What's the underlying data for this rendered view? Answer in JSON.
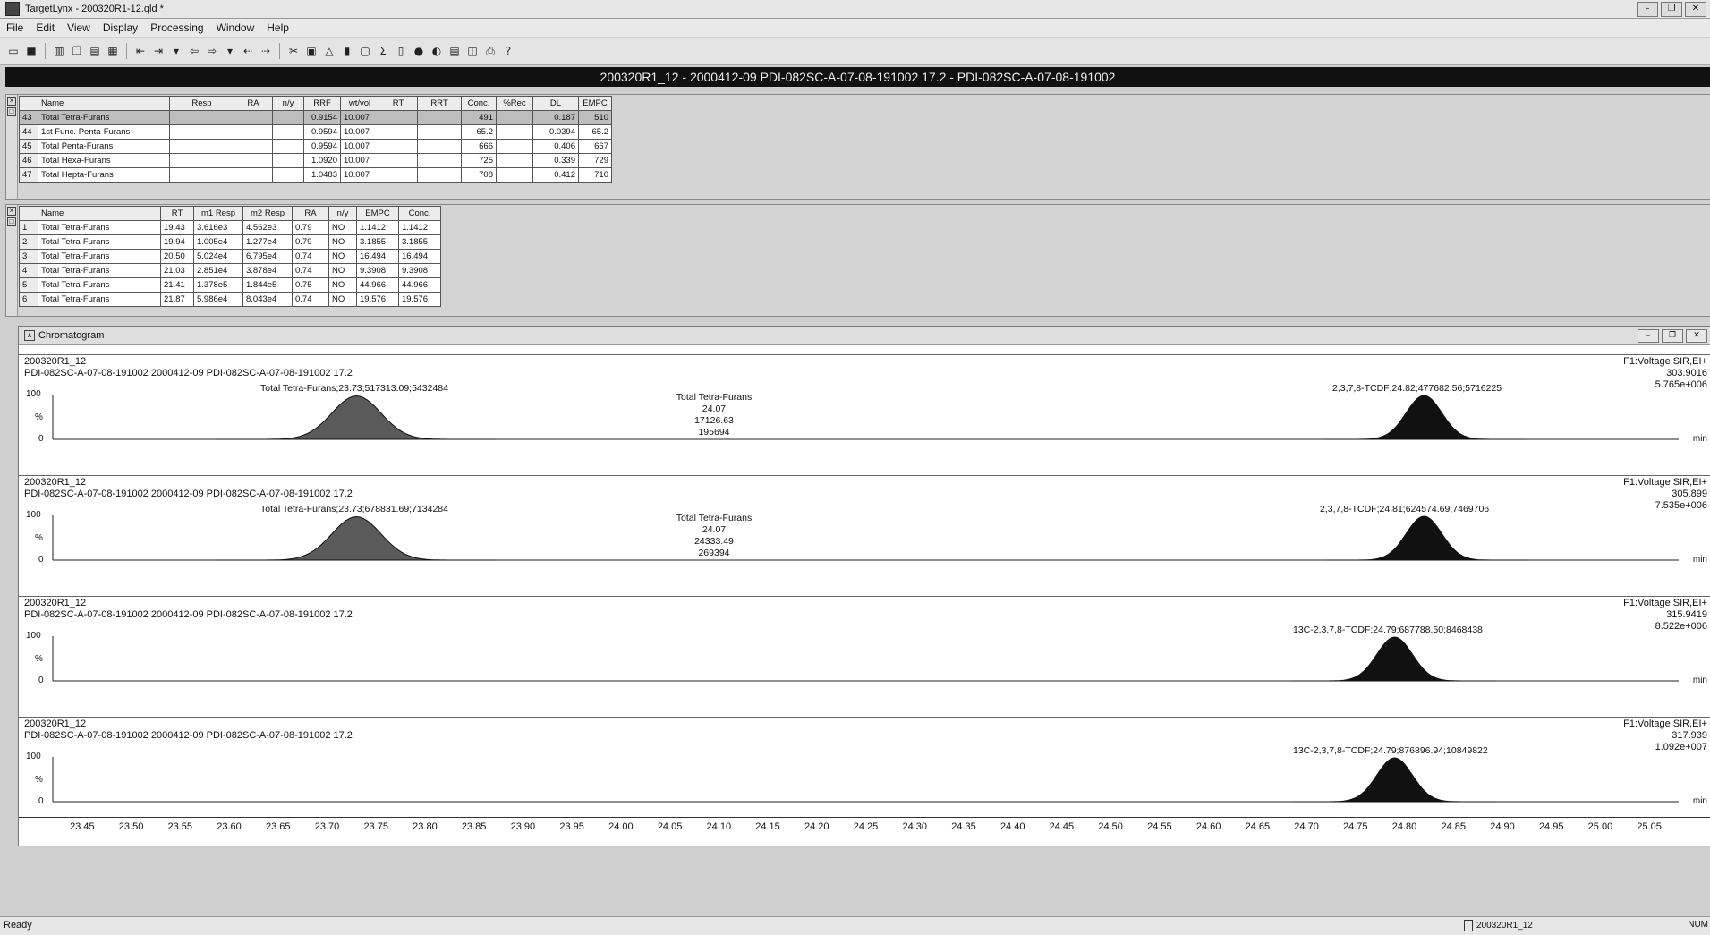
{
  "window": {
    "title": "TargetLynx - 200320R1-12.qld *",
    "buttons": [
      "–",
      "❐",
      "✕"
    ]
  },
  "menu": [
    "File",
    "Edit",
    "View",
    "Display",
    "Processing",
    "Window",
    "Help"
  ],
  "banner": "200320R1_12 - 2000412-09 PDI-082SC-A-07-08-191002 17.2 - PDI-082SC-A-07-08-191002",
  "summary_table": {
    "headers": [
      "Name",
      "Resp",
      "RA",
      "n/y",
      "RRF",
      "wt/vol",
      "RT",
      "RRT",
      "Conc.",
      "%Rec",
      "DL",
      "EMPC"
    ],
    "rows": [
      [
        "43",
        "Total Tetra-Furans",
        "",
        "",
        "",
        "0.9154",
        "10.007",
        "",
        "",
        "491",
        "",
        "0.187",
        "510"
      ],
      [
        "44",
        "1st Func. Penta-Furans",
        "",
        "",
        "",
        "0.9594",
        "10.007",
        "",
        "",
        "65.2",
        "",
        "0.0394",
        "65.2"
      ],
      [
        "45",
        "Total Penta-Furans",
        "",
        "",
        "",
        "0.9594",
        "10.007",
        "",
        "",
        "666",
        "",
        "0.406",
        "667"
      ],
      [
        "46",
        "Total Hexa-Furans",
        "",
        "",
        "",
        "1.0920",
        "10.007",
        "",
        "",
        "725",
        "",
        "0.339",
        "729"
      ],
      [
        "47",
        "Total Hepta-Furans",
        "",
        "",
        "",
        "1.0483",
        "10.007",
        "",
        "",
        "708",
        "",
        "0.412",
        "710"
      ]
    ]
  },
  "peak_table": {
    "headers": [
      "Name",
      "RT",
      "m1 Resp",
      "m2 Resp",
      "RA",
      "n/y",
      "EMPC",
      "Conc."
    ],
    "rows": [
      [
        "1",
        "Total Tetra-Furans",
        "19.43",
        "3.616e3",
        "4.562e3",
        "0.79",
        "NO",
        "1.1412",
        "1.1412"
      ],
      [
        "2",
        "Total Tetra-Furans",
        "19.94",
        "1.005e4",
        "1.277e4",
        "0.79",
        "NO",
        "3.1855",
        "3.1855"
      ],
      [
        "3",
        "Total Tetra-Furans",
        "20.50",
        "5.024e4",
        "6.795e4",
        "0.74",
        "NO",
        "16.494",
        "16.494"
      ],
      [
        "4",
        "Total Tetra-Furans",
        "21.03",
        "2.851e4",
        "3.878e4",
        "0.74",
        "NO",
        "9.3908",
        "9.3908"
      ],
      [
        "5",
        "Total Tetra-Furans",
        "21.41",
        "1.378e5",
        "1.844e5",
        "0.75",
        "NO",
        "44.966",
        "44.966"
      ],
      [
        "6",
        "Total Tetra-Furans",
        "21.87",
        "5.986e4",
        "8.043e4",
        "0.74",
        "NO",
        "19.576",
        "19.576"
      ]
    ]
  },
  "chromatogram": {
    "title": "Chromatogram",
    "x_unit": "min",
    "x_ticks": [
      "23.45",
      "23.50",
      "23.55",
      "23.60",
      "23.65",
      "23.70",
      "23.75",
      "23.80",
      "23.85",
      "23.90",
      "23.95",
      "24.00",
      "24.05",
      "24.10",
      "24.15",
      "24.20",
      "24.25",
      "24.30",
      "24.35",
      "24.40",
      "24.45",
      "24.50",
      "24.55",
      "24.60",
      "24.65",
      "24.70",
      "24.75",
      "24.80",
      "24.85",
      "24.90",
      "24.95",
      "25.00",
      "25.05"
    ],
    "y_labels": [
      "100",
      "%",
      "0"
    ],
    "traces": [
      {
        "sample": "200320R1_12",
        "desc": "PDI-082SC-A-07-08-191002 2000412-09 PDI-082SC-A-07-08-191002 17.2",
        "fn": "F1:Voltage SIR,EI+",
        "mass": "303.9016",
        "intensity": "5.765e+006",
        "peak1": "Total Tetra-Furans;23.73;517313.09;5432484",
        "mid": [
          "Total Tetra-Furans",
          "24.07",
          "17126.63",
          "195694"
        ],
        "peak2": "2,3,7,8-TCDF;24.82;477682.56;5716225"
      },
      {
        "sample": "200320R1_12",
        "desc": "PDI-082SC-A-07-08-191002 2000412-09 PDI-082SC-A-07-08-191002 17.2",
        "fn": "F1:Voltage SIR,EI+",
        "mass": "305.899",
        "intensity": "7.535e+006",
        "peak1": "Total Tetra-Furans;23.73;678831.69;7134284",
        "mid": [
          "Total Tetra-Furans",
          "24.07",
          "24333.49",
          "269394"
        ],
        "peak2": "2,3,7,8-TCDF;24.81;624574.69;7469706"
      },
      {
        "sample": "200320R1_12",
        "desc": "PDI-082SC-A-07-08-191002 2000412-09 PDI-082SC-A-07-08-191002 17.2",
        "fn": "F1:Voltage SIR,EI+",
        "mass": "315.9419",
        "intensity": "8.522e+006",
        "peak1": "",
        "mid": [],
        "peak2": "13C-2,3,7,8-TCDF;24.79;687788.50;8468438"
      },
      {
        "sample": "200320R1_12",
        "desc": "PDI-082SC-A-07-08-191002 2000412-09 PDI-082SC-A-07-08-191002 17.2",
        "fn": "F1:Voltage SIR,EI+",
        "mass": "317.939",
        "intensity": "1.092e+007",
        "peak1": "",
        "mid": [],
        "peak2": "13C-2,3,7,8-TCDF;24.79;876896.94;10849822"
      }
    ]
  },
  "chart_data": {
    "type": "line",
    "title": "Chromatogram",
    "xlabel": "min",
    "xlim": [
      23.42,
      25.08
    ],
    "ylim": [
      0,
      100
    ],
    "series": [
      {
        "name": "303.9016",
        "peaks": [
          {
            "x": 23.73,
            "height": 97,
            "width": 0.055,
            "shaded": true
          },
          {
            "x": 24.82,
            "height": 98,
            "width": 0.04,
            "shaded": false
          }
        ]
      },
      {
        "name": "305.899",
        "peaks": [
          {
            "x": 23.73,
            "height": 97,
            "width": 0.055,
            "shaded": true
          },
          {
            "x": 24.82,
            "height": 98,
            "width": 0.04,
            "shaded": false
          }
        ]
      },
      {
        "name": "315.9419",
        "peaks": [
          {
            "x": 24.79,
            "height": 98,
            "width": 0.04,
            "shaded": false
          }
        ]
      },
      {
        "name": "317.939",
        "peaks": [
          {
            "x": 24.79,
            "height": 98,
            "width": 0.04,
            "shaded": false
          }
        ]
      }
    ]
  },
  "status": {
    "left": "Ready",
    "file": "200320R1_12",
    "num": "NUM"
  }
}
